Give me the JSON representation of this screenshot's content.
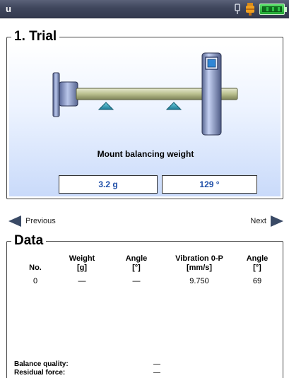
{
  "status_bar": {
    "app_label": "u",
    "icons": [
      "usb-plug-icon",
      "sensor-icon",
      "battery-icon"
    ],
    "accent": "#3f465c"
  },
  "trial": {
    "title": "1. Trial",
    "instruction": "Mount balancing weight",
    "weight_value": "3.2 g",
    "angle_value": "129 °"
  },
  "navigation": {
    "previous_label": "Previous",
    "next_label": "Next"
  },
  "data": {
    "title": "Data",
    "columns": [
      {
        "line1": "No.",
        "line2": ""
      },
      {
        "line1": "Weight",
        "line2": "[g]"
      },
      {
        "line1": "Angle",
        "line2": "[°]"
      },
      {
        "line1": "Vibration 0-P",
        "line2": "[mm/s]"
      },
      {
        "line1": "Angle",
        "line2": "[°]"
      }
    ],
    "rows": [
      [
        "0",
        "—",
        "—",
        "9.750",
        "69"
      ]
    ],
    "balance_quality_label": "Balance quality:",
    "balance_quality_value": "—",
    "residual_force_label": "Residual force:",
    "residual_force_value": "—"
  }
}
